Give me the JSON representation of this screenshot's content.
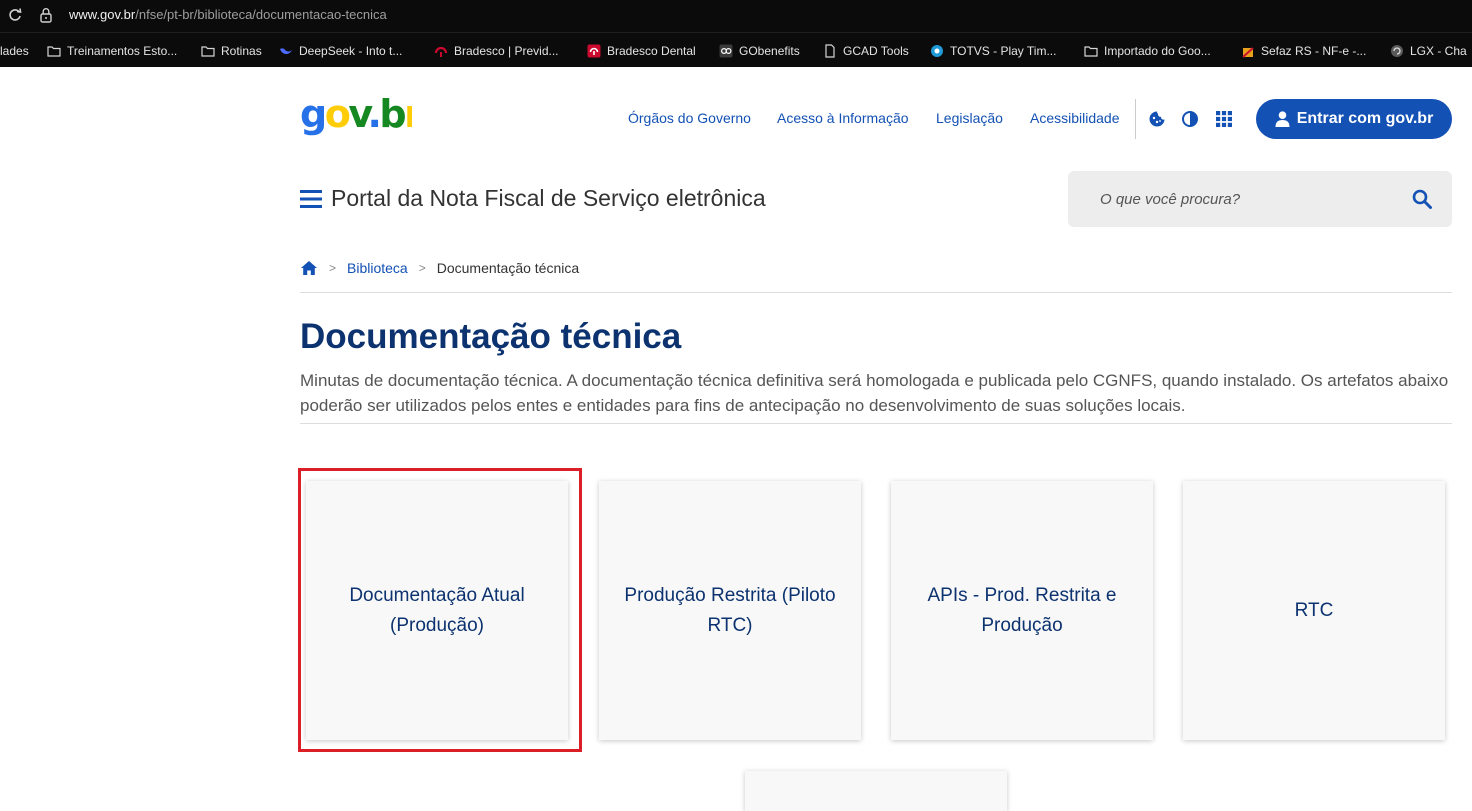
{
  "browser": {
    "url_host": "www.gov.br",
    "url_path": "/nfse/pt-br/biblioteca/documentacao-tecnica",
    "bookmarks": [
      {
        "label": "lades",
        "icon": "none"
      },
      {
        "label": "Treinamentos Esto...",
        "icon": "folder-icon"
      },
      {
        "label": "Rotinas",
        "icon": "folder-icon"
      },
      {
        "label": "DeepSeek - Into t...",
        "icon": "deepseek-icon"
      },
      {
        "label": "Bradesco | Previd...",
        "icon": "bradesco-icon"
      },
      {
        "label": "Bradesco Dental",
        "icon": "bradesco-dental-icon"
      },
      {
        "label": "GObenefits",
        "icon": "gobenefits-icon"
      },
      {
        "label": "GCAD Tools",
        "icon": "page-icon"
      },
      {
        "label": "TOTVS - Play Tim...",
        "icon": "totvs-icon"
      },
      {
        "label": "Importado do Goo...",
        "icon": "folder-icon"
      },
      {
        "label": "Sefaz RS - NF-e -...",
        "icon": "sefaz-icon"
      },
      {
        "label": "LGX - Cha",
        "icon": "lgx-icon"
      }
    ]
  },
  "header": {
    "logo_text": "gov.br",
    "nav": [
      "Órgãos do Governo",
      "Acesso à Informação",
      "Legislação",
      "Acessibilidade"
    ],
    "icons": [
      "cookie-icon",
      "contrast-icon",
      "apps-grid-icon"
    ],
    "login_label": "Entrar com gov.br",
    "portal_title": "Portal da Nota Fiscal de Serviço eletrônica",
    "search_placeholder": "O que você procura?"
  },
  "breadcrumb": {
    "home_icon": "home-icon",
    "items": [
      "Biblioteca",
      "Documentação técnica"
    ]
  },
  "page": {
    "title": "Documentação técnica",
    "description": "Minutas de documentação técnica. A documentação técnica definitiva será homologada e publicada pelo CGNFS, quando instalado. Os artefatos abaixo poderão ser utilizados pelos entes e entidades para fins de antecipação no desenvolvimento de suas soluções locais."
  },
  "cards": [
    {
      "label": "Documentação Atual (Produção)",
      "highlighted": true
    },
    {
      "label": "Produção Restrita (Piloto RTC)",
      "highlighted": false
    },
    {
      "label": "APIs - Prod. Restrita e Produção",
      "highlighted": false
    },
    {
      "label": "RTC",
      "highlighted": false
    }
  ],
  "colors": {
    "primary": "#1351b4",
    "title": "#0c326f",
    "highlight": "#dc1f26",
    "logo_blue": "#2670e8",
    "logo_green": "#168821",
    "logo_yellow": "#ffcd07"
  }
}
